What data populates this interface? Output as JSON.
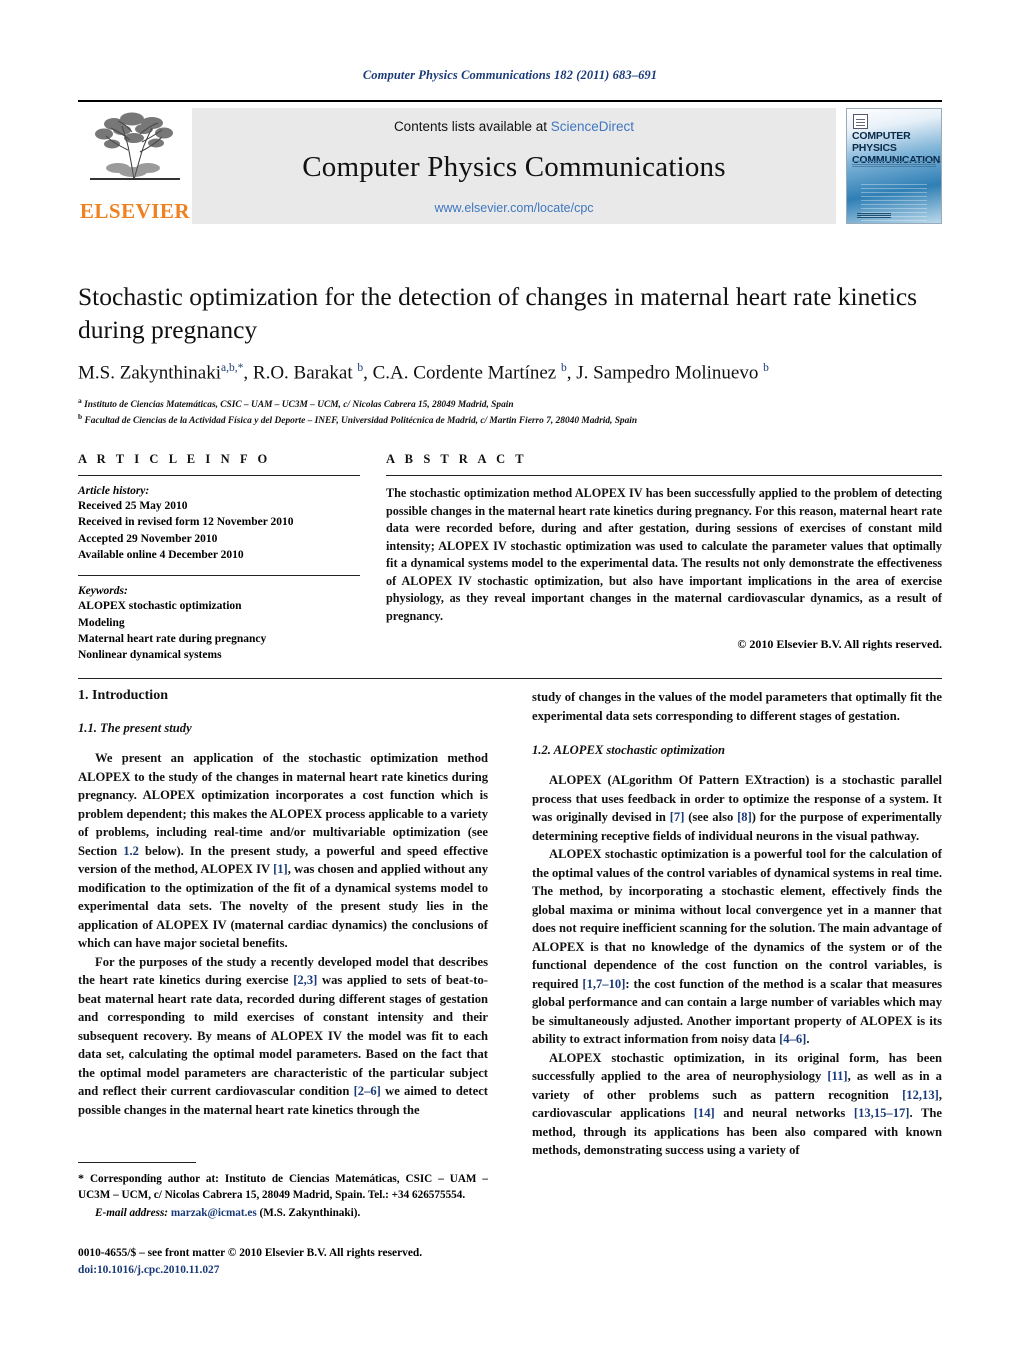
{
  "running_head": "Computer Physics Communications 182 (2011) 683–691",
  "masthead": {
    "contents_prefix": "Contents lists available at ",
    "contents_link": "ScienceDirect",
    "journal_title": "Computer Physics Communications",
    "journal_url": "www.elsevier.com/locate/cpc",
    "publisher_name": "ELSEVIER",
    "cover_title": "COMPUTER PHYSICS COMMUNICATIONS",
    "link_color": "#3f77c0",
    "publisher_color": "#F08020"
  },
  "title_block": {
    "title": "Stochastic optimization for the detection of changes in maternal heart rate kinetics during pregnancy",
    "authors": [
      {
        "name": "M.S. Zakynthinaki",
        "marks": "a,b,*"
      },
      {
        "name": "R.O. Barakat",
        "marks": "b"
      },
      {
        "name": "C.A. Cordente Martínez",
        "marks": "b"
      },
      {
        "name": "J. Sampedro Molinuevo",
        "marks": "b"
      }
    ],
    "affiliations": [
      {
        "mark": "a",
        "text": "Instituto de Ciencias Matemáticas, CSIC – UAM – UC3M – UCM, c/ Nicolas Cabrera 15, 28049 Madrid, Spain"
      },
      {
        "mark": "b",
        "text": "Facultad de Ciencias de la Actividad Física y del Deporte – INEF, Universidad Politécnica de Madrid, c/ Martin Fierro 7, 28040 Madrid, Spain"
      }
    ]
  },
  "article_info": {
    "heading": "A R T I C L E    I N F O",
    "history_title": "Article history:",
    "history": [
      "Received 25 May 2010",
      "Received in revised form 12 November 2010",
      "Accepted 29 November 2010",
      "Available online 4 December 2010"
    ],
    "keywords_title": "Keywords:",
    "keywords": [
      "ALOPEX stochastic optimization",
      "Modeling",
      "Maternal heart rate during pregnancy",
      "Nonlinear dynamical systems"
    ]
  },
  "abstract": {
    "heading": "A B S T R A C T",
    "text": "The stochastic optimization method ALOPEX IV has been successfully applied to the problem of detecting possible changes in the maternal heart rate kinetics during pregnancy. For this reason, maternal heart rate data were recorded before, during and after gestation, during sessions of exercises of constant mild intensity; ALOPEX IV stochastic optimization was used to calculate the parameter values that optimally fit a dynamical systems model to the experimental data. The results not only demonstrate the effectiveness of ALOPEX IV stochastic optimization, but also have important implications in the area of exercise physiology, as they reveal important changes in the maternal cardiovascular dynamics, as a result of pregnancy.",
    "copyright": "© 2010 Elsevier B.V. All rights reserved."
  },
  "body": {
    "section_1": "1. Introduction",
    "subsection_1_1": "1.1. The present study",
    "subsection_1_2": "1.2. ALOPEX stochastic optimization",
    "left_p1_a": "We present an application of the stochastic optimization method ALOPEX to the study of the changes in maternal heart rate kinetics during pregnancy. ALOPEX optimization incorporates a cost function which is problem dependent; this makes the ALOPEX process applicable to a variety of problems, including real-time and/or multivariable optimization (see Section ",
    "left_p1_ref1": "1.2",
    "left_p1_b": " below). In the present study, a powerful and speed effective version of the method, ALOPEX IV ",
    "left_p1_ref2": "[1]",
    "left_p1_c": ", was chosen and applied without any modification to the optimization of the fit of a dynamical systems model to experimental data sets. The novelty of the present study lies in the application of ALOPEX IV (maternal cardiac dynamics) the conclusions of which can have major societal benefits.",
    "left_p2_a": "For the purposes of the study a recently developed model that describes the heart rate kinetics during exercise ",
    "left_p2_ref1": "[2,3]",
    "left_p2_b": " was applied to sets of beat-to-beat maternal heart rate data, recorded during different stages of gestation and corresponding to mild exercises of constant intensity and their subsequent recovery. By means of ALOPEX IV the model was fit to each data set, calculating the optimal model parameters. Based on the fact that the optimal model parameters are characteristic of the particular subject and reflect their current cardiovascular condition ",
    "left_p2_ref2": "[2–6]",
    "left_p2_c": " we aimed to detect possible changes in the maternal heart rate kinetics through the",
    "right_p0": "study of changes in the values of the model parameters that optimally fit the experimental data sets corresponding to different stages of gestation.",
    "right_p1_a": "ALOPEX (ALgorithm Of Pattern EXtraction) is a stochastic parallel process that uses feedback in order to optimize the response of a system. It was originally devised in ",
    "right_p1_ref1": "[7]",
    "right_p1_b": " (see also ",
    "right_p1_ref2": "[8]",
    "right_p1_c": ") for the purpose of experimentally determining receptive fields of individual neurons in the visual pathway.",
    "right_p2_a": "ALOPEX stochastic optimization is a powerful tool for the calculation of the optimal values of the control variables of dynamical systems in real time. The method, by incorporating a stochastic element, effectively finds the global maxima or minima without local convergence yet in a manner that does not require inefficient scanning for the solution. The main advantage of ALOPEX is that no knowledge of the dynamics of the system or of the functional dependence of the cost function on the control variables, is required ",
    "right_p2_ref1": "[1,7–10]",
    "right_p2_b": ": the cost function of the method is a scalar that measures global performance and can contain a large number of variables which may be simultaneously adjusted. Another important property of ALOPEX is its ability to extract information from noisy data ",
    "right_p2_ref2": "[4–6]",
    "right_p2_c": ".",
    "right_p3_a": "ALOPEX stochastic optimization, in its original form, has been successfully applied to the area of neurophysiology ",
    "right_p3_ref1": "[11]",
    "right_p3_b": ", as well as in a variety of other problems such as pattern recognition ",
    "right_p3_ref2": "[12,13]",
    "right_p3_c": ", cardiovascular applications ",
    "right_p3_ref3": "[14]",
    "right_p3_d": " and neural networks ",
    "right_p3_ref4": "[13,15–17]",
    "right_p3_e": ". The method, through its applications has been also compared with known methods, demonstrating success using a variety of"
  },
  "footer": {
    "corresponding_star": "*",
    "corresponding_text": " Corresponding author at: Instituto de Ciencias Matemáticas, CSIC – UAM – UC3M – UCM, c/ Nicolas Cabrera 15, 28049 Madrid, Spain. Tel.: +34 626575554.",
    "email_label": "E-mail address:",
    "email": "marzak@icmat.es",
    "email_owner": "(M.S. Zakynthinaki).",
    "issn_line": "0010-4655/$ – see front matter  © 2010 Elsevier B.V. All rights reserved.",
    "doi": "doi:10.1016/j.cpc.2010.11.027"
  }
}
